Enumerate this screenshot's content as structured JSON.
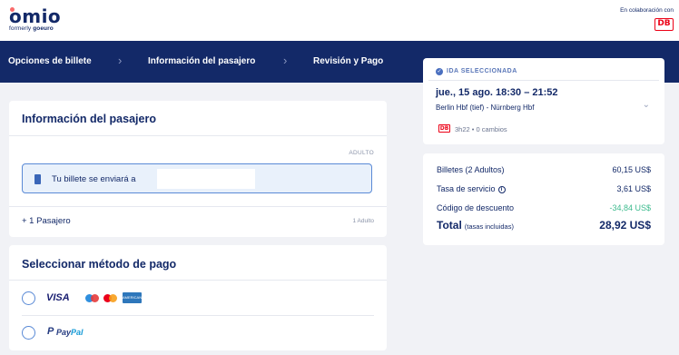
{
  "brand": {
    "logo_text": "omio",
    "tagline_prefix": "formerly",
    "tagline_brand": "goeuro",
    "partner_text": "En colaboración con",
    "partner_logo": "DB"
  },
  "nav": {
    "steps": [
      "Opciones de billete",
      "Información del pasajero",
      "Revisión y Pago"
    ],
    "separator": "›"
  },
  "passenger": {
    "title": "Información del pasajero",
    "category": "ADULTO",
    "ticket_text": "Tu billete se enviará a",
    "add_passenger": "+ 1 Pasajero",
    "count": "1 Adulto"
  },
  "payment": {
    "title": "Seleccionar método de pago",
    "options": [
      {
        "name": "visa",
        "label": "VISA"
      },
      {
        "name": "paypal",
        "label_pay": "Pay",
        "label_pal": "Pal"
      }
    ],
    "amex_label": "AMERICAN EXPRESS"
  },
  "trip": {
    "status": "IDA SELECCIONADA",
    "date_time": "jue., 15 ago.   18:30 – 21:52",
    "route": "Berlin Hbf (tief)  -  Nürnberg Hbf",
    "operator": "DB",
    "duration": "3h22 • 0 cambios"
  },
  "pricing": {
    "rows": [
      {
        "label": "Billetes  (2 Adultos)",
        "value": "60,15 US$"
      },
      {
        "label": "Tasa de servicio",
        "value": "3,61 US$"
      },
      {
        "label": "Código de descuento",
        "value": "-34,84 US$"
      }
    ],
    "total_label": "Total",
    "total_note": "(tasas incluidas)",
    "total_value": "28,92 US$"
  },
  "colors": {
    "brand_navy": "#132968",
    "discount_green": "#3dbb8e",
    "db_red": "#ec0016",
    "accent_blue": "#5a8ad6"
  }
}
